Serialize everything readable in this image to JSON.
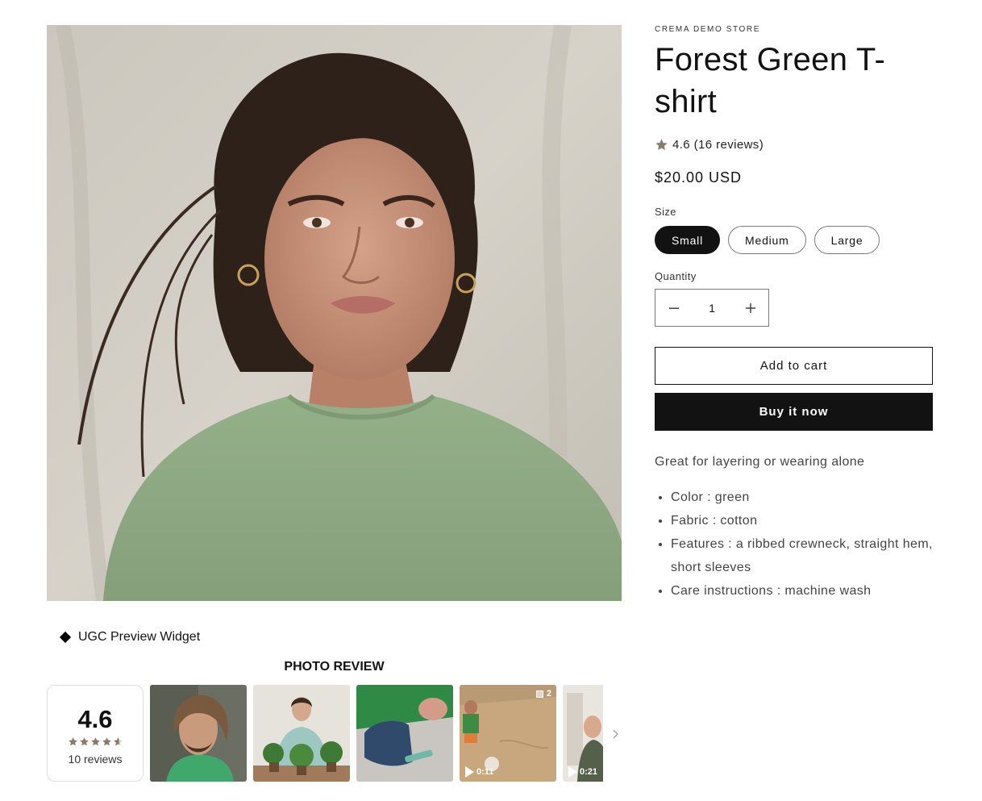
{
  "product": {
    "vendor": "CREMA DEMO STORE",
    "title": "Forest Green T-shirt",
    "rating_text": "4.6 (16 reviews)",
    "price": "$20.00 USD",
    "size_label": "Size",
    "sizes": [
      {
        "label": "Small",
        "selected": true
      },
      {
        "label": "Medium",
        "selected": false
      },
      {
        "label": "Large",
        "selected": false
      }
    ],
    "quantity_label": "Quantity",
    "quantity_value": "1",
    "add_to_cart_label": "Add to cart",
    "buy_now_label": "Buy it now",
    "description": "Great for layering or wearing alone",
    "features": [
      "Color : green",
      "Fabric : cotton",
      "Features : a ribbed crewneck, straight hem, short sleeves",
      "Care instructions : machine wash"
    ]
  },
  "ugc": {
    "widget_title": "UGC Preview Widget",
    "section_heading": "PHOTO REVIEW",
    "rating_value": "4.6",
    "rating_stars": 4.6,
    "review_count": "10 reviews",
    "thumbnails": [
      {
        "kind": "photo",
        "subject": "man with long hair in green shirt"
      },
      {
        "kind": "photo",
        "subject": "woman potting plants"
      },
      {
        "kind": "photo",
        "subject": "kids drawing with chalk"
      },
      {
        "kind": "video",
        "duration": "0:11",
        "multi_count": "2",
        "subject": "child on beach"
      },
      {
        "kind": "video",
        "duration": "0:21",
        "subject": "child indoors"
      }
    ]
  },
  "colors": {
    "text": "#121212",
    "button_dark": "#121212",
    "star": "#8a7a6a",
    "shirt_green": "#8fac83"
  },
  "icons": {
    "rating_star": "star-icon",
    "quantity_minus": "minus-icon",
    "quantity_plus": "plus-icon",
    "strip_next": "chevron-right-icon",
    "video": "play-icon",
    "multi": "gallery-icon"
  }
}
